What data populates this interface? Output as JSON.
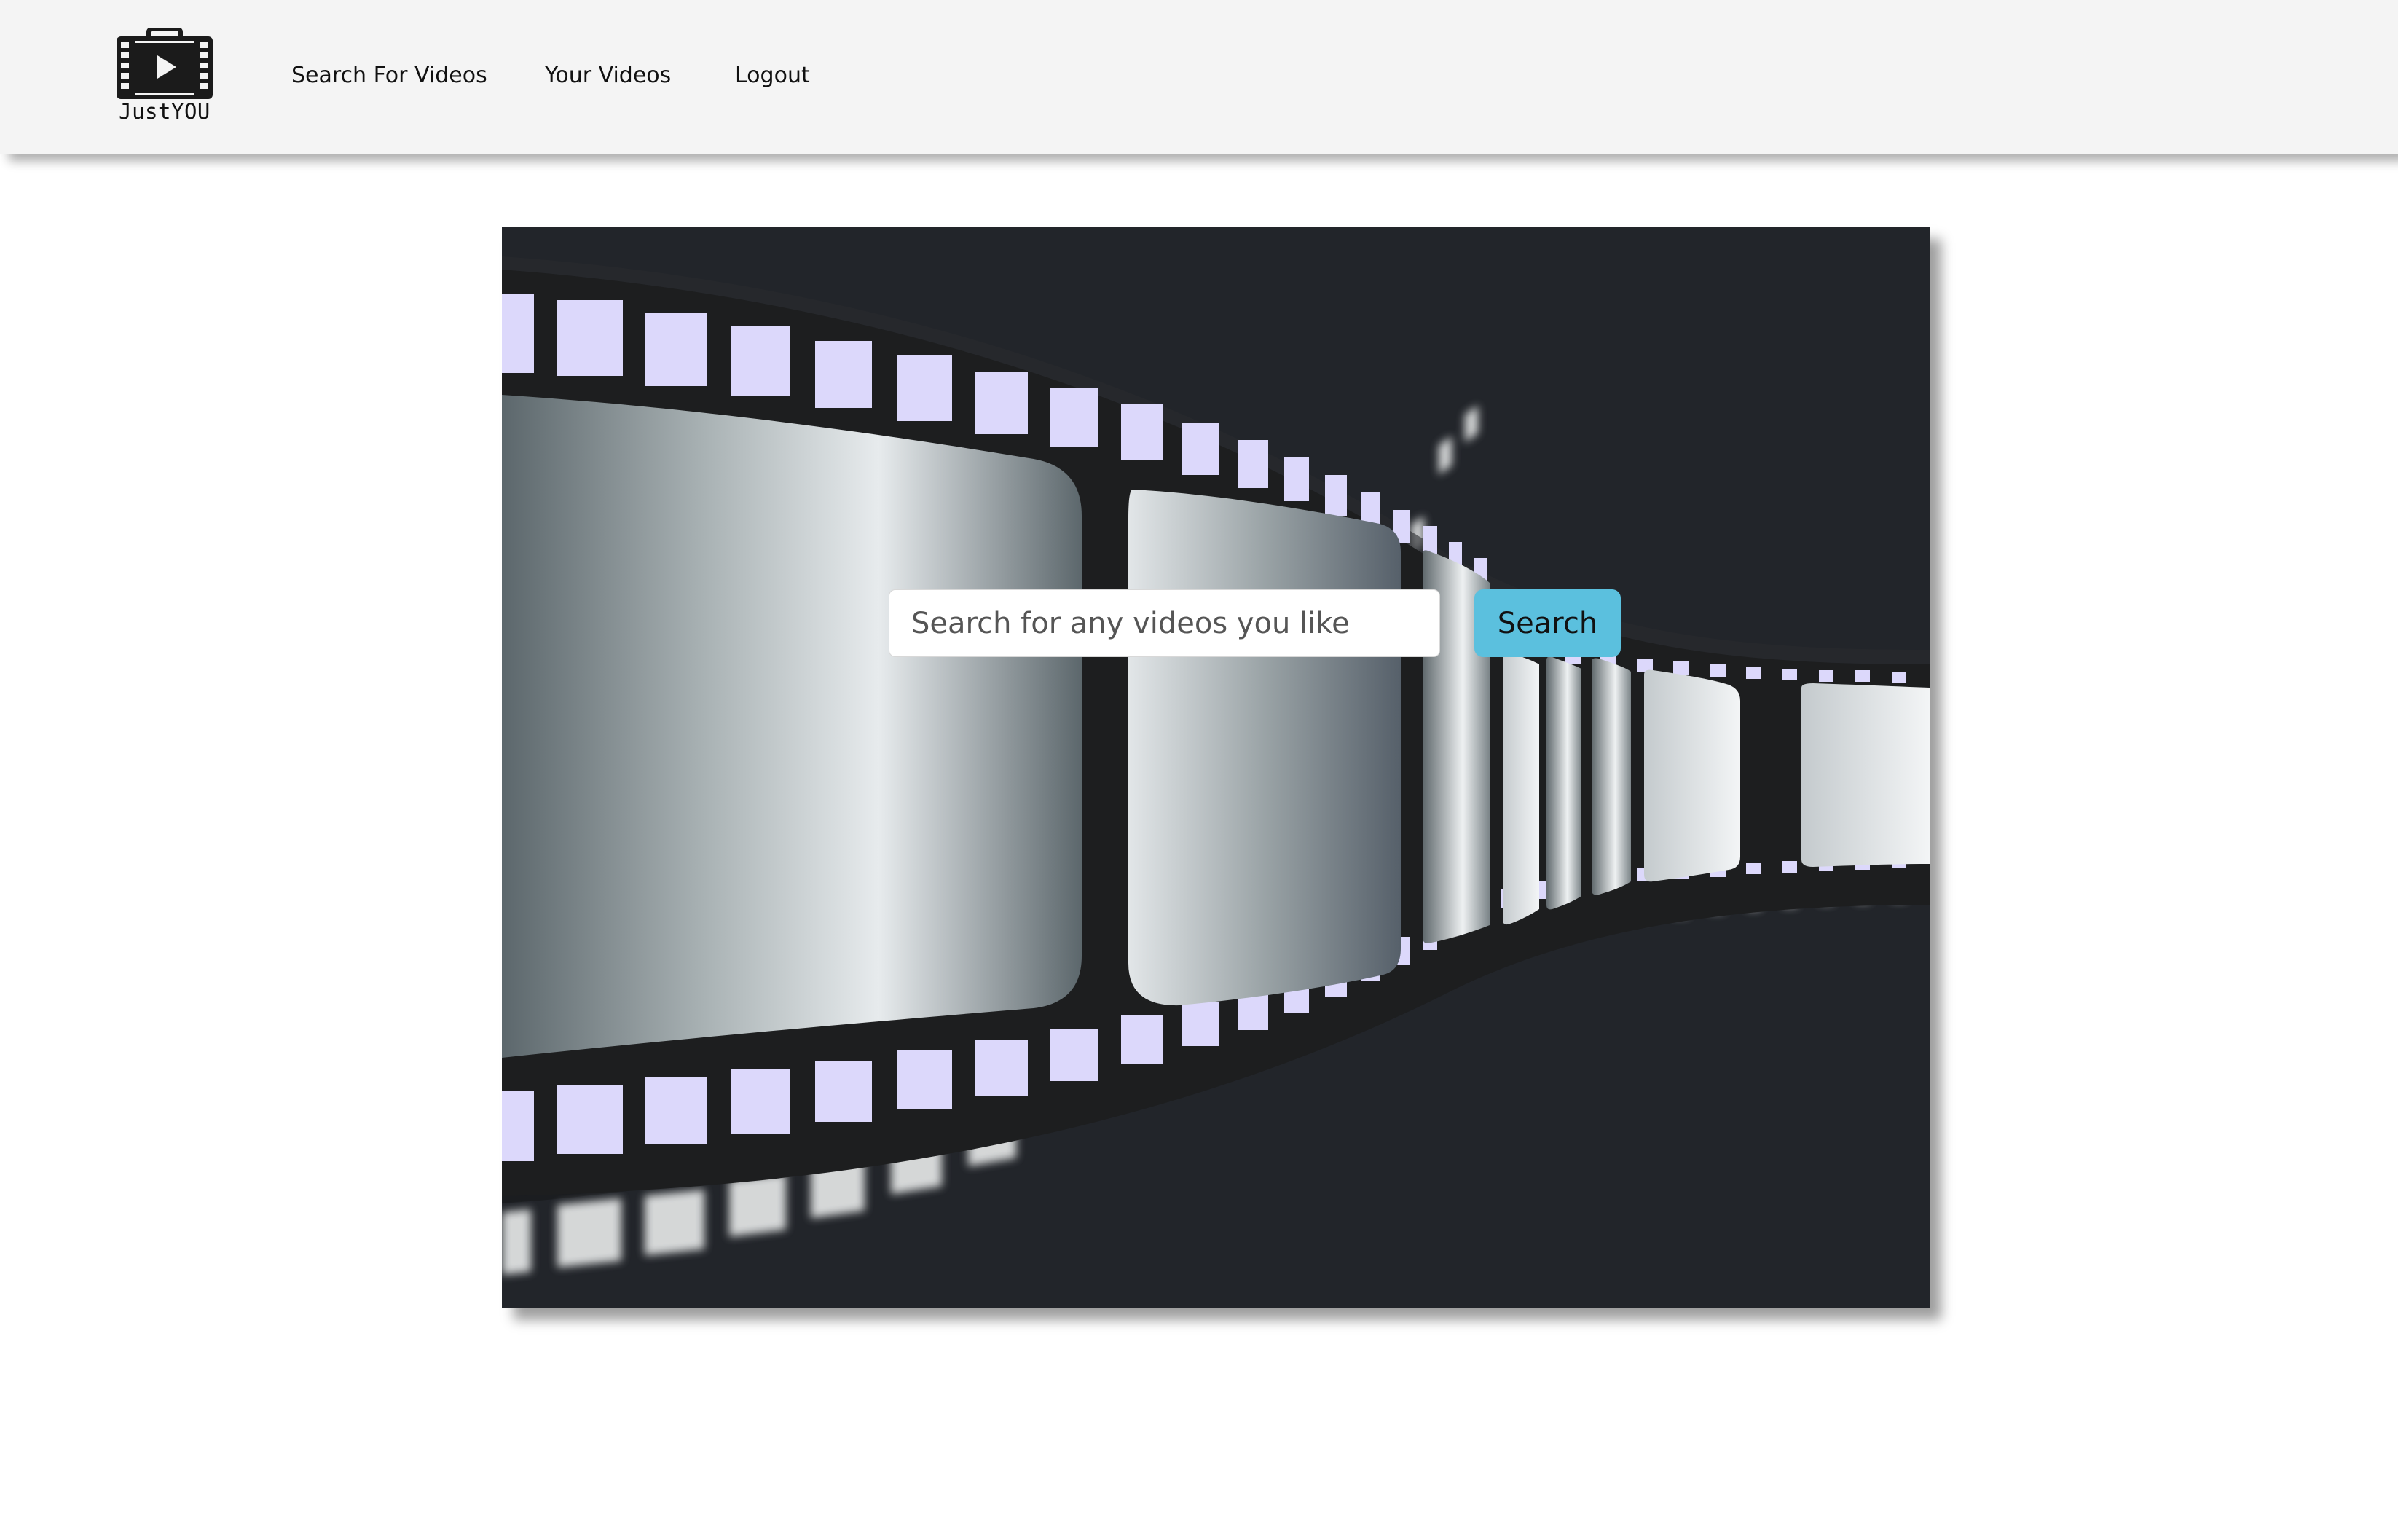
{
  "brand": {
    "name": "JustYOU",
    "logo_icon": "film-suitcase-play-icon"
  },
  "nav": {
    "items": [
      {
        "label": "Search For Videos"
      },
      {
        "label": "Your Videos"
      },
      {
        "label": "Logout"
      }
    ]
  },
  "hero": {
    "background_image": "film-strip-illustration",
    "search": {
      "placeholder": "Search for any videos you like",
      "value": "",
      "button_label": "Search"
    }
  },
  "colors": {
    "navbar_bg": "#f4f4f4",
    "hero_bg": "#22252a",
    "accent_button": "#5bc0de",
    "sprocket_hole": "#dcd8fb"
  }
}
